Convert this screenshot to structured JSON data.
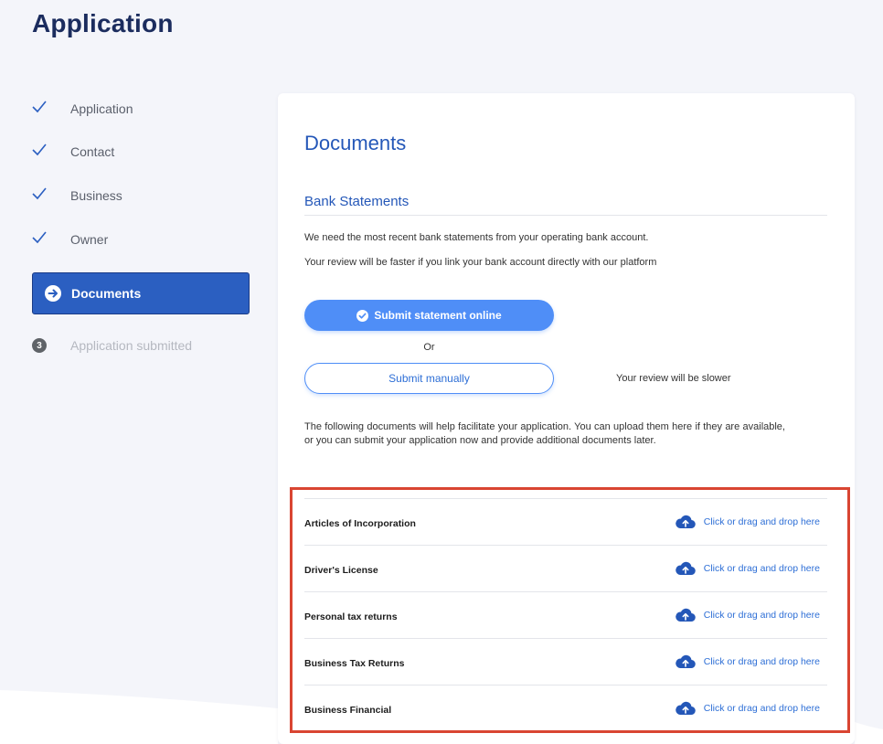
{
  "page": {
    "title": "Application"
  },
  "sidebar": {
    "steps": [
      {
        "label": "Application",
        "state": "done"
      },
      {
        "label": "Contact",
        "state": "done"
      },
      {
        "label": "Business",
        "state": "done"
      },
      {
        "label": "Owner",
        "state": "done"
      },
      {
        "label": "Documents",
        "state": "active"
      },
      {
        "label": "Application submitted",
        "state": "pending",
        "number": "3"
      }
    ]
  },
  "main": {
    "title": "Documents",
    "bank": {
      "title": "Bank Statements",
      "desc1": "We need the most recent bank statements from your operating bank account.",
      "desc2": "Your review will be faster if you link your bank account directly with our platform",
      "online_button": "Submit statement online",
      "or_label": "Or",
      "manual_button": "Submit manually",
      "slower_note": "Your review will be slower"
    },
    "docs_intro": "The following documents will help facilitate your application. You can upload them here if they are available, or you can submit your application now and provide additional documents later.",
    "documents": [
      {
        "name": "Articles of Incorporation",
        "action": "Click or drag and drop here"
      },
      {
        "name": "Driver's License",
        "action": "Click or drag and drop here"
      },
      {
        "name": "Personal tax returns",
        "action": "Click or drag and drop here"
      },
      {
        "name": "Business Tax Returns",
        "action": "Click or drag and drop here"
      },
      {
        "name": "Business Financial",
        "action": "Click or drag and drop here"
      }
    ]
  },
  "colors": {
    "brand_navy": "#1b2c5e",
    "accent_blue": "#2457b8",
    "button_blue": "#4f8ef7",
    "active_step": "#2b5fc1",
    "highlight_red": "#d94532"
  }
}
